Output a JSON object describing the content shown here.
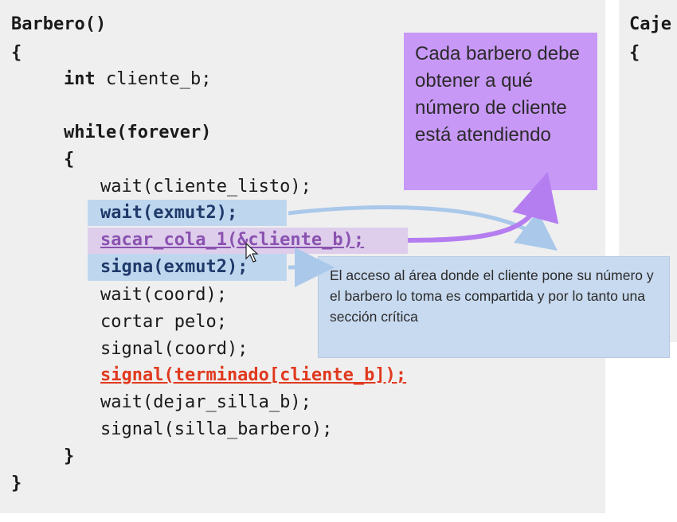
{
  "code": {
    "lines": [
      "Barbero()",
      "{",
      "int cliente_b;",
      "while(forever)",
      "{",
      "wait(cliente_listo);",
      "wait(exmut2);",
      "sacar_cola_1(&cliente_b);",
      "signa(exmut2);",
      "wait(coord);",
      "cortar pelo;",
      "signal(coord);",
      "signal(terminado[cliente_b]);",
      "wait(dejar_silla_b);",
      "signal(silla_barbero);",
      "}",
      "}"
    ],
    "int_kw": "int",
    "int_rest": " cliente_b;"
  },
  "side": {
    "title": "Caje",
    "brace": "{"
  },
  "callouts": {
    "purple": "Cada barbero debe obtener a qué número de cliente está atendiendo",
    "blue": "El acceso al área donde el cliente pone su número y el barbero lo toma es compartida y por lo tanto una sección crítica"
  },
  "colors": {
    "panel": "#efefef",
    "blue_highlight": "#bfd7ee",
    "purple_callout": "#c898f7",
    "blue_callout": "#c8daf0",
    "red_text": "#e0391e",
    "purple_text": "#8a52b0",
    "blue_text": "#1f3a6b"
  }
}
